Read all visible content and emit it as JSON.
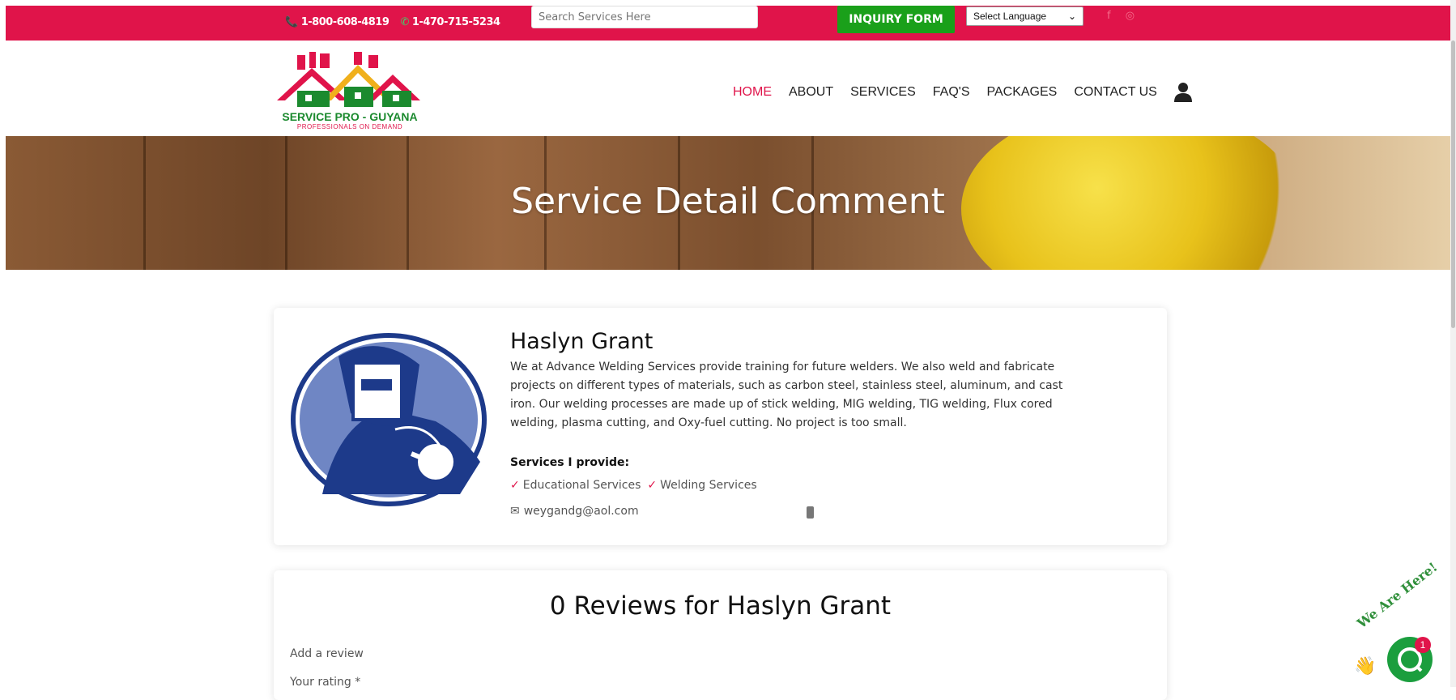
{
  "topbar": {
    "phone1": "📞 1-800-608-4819",
    "phone2": "1-470-715-5234",
    "search_placeholder": "Search Services Here",
    "inquiry_label": "INQUIRY FORM",
    "language_label": "Select Language",
    "social": [
      "facebook-icon",
      "instagram-icon"
    ],
    "accent_color": "#e0144a"
  },
  "logo": {
    "line1": "SERVICE PRO - GUYANA",
    "line2": "PROFESSIONALS ON DEMAND"
  },
  "nav": {
    "items": [
      "HOME",
      "ABOUT",
      "SERVICES",
      "FAQ'S",
      "PACKAGES",
      "CONTACT US"
    ],
    "active": "HOME"
  },
  "hero": {
    "title": "Service Detail Comment"
  },
  "profile": {
    "name": "Haslyn Grant",
    "bio": "We at Advance Welding Services provide training for future welders. We also weld and fabricate projects on different types of materials, such as carbon steel, stainless steel, aluminum, and cast iron. Our welding processes are made up of stick welding, MIG welding, TIG welding, Flux cored welding, plasma cutting, and Oxy-fuel cutting. No project is too small.",
    "services_label": "Services I provide:",
    "services": [
      "Educational Services",
      "Welding Services"
    ],
    "email": "weygandg@aol.com"
  },
  "reviews": {
    "title": "0 Reviews for Haslyn Grant",
    "add_review": "Add a review",
    "your_rating": "Your rating *"
  },
  "chat": {
    "badge_count": "1",
    "bubble_text": "We Are Here!",
    "brand_color": "#1b9e3e"
  }
}
